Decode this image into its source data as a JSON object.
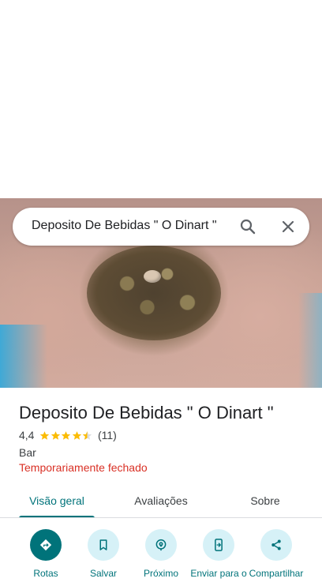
{
  "search": {
    "query": "Deposito De Bebidas \" O Dinart \""
  },
  "place": {
    "title": "Deposito De Bebidas \" O Dinart \"",
    "rating": "4,4",
    "stars": 4.4,
    "review_count": "(11)",
    "category": "Bar",
    "status": "Temporariamente fechado"
  },
  "tabs": [
    {
      "label": "Visão geral",
      "active": true
    },
    {
      "label": "Avaliações",
      "active": false
    },
    {
      "label": "Sobre",
      "active": false
    }
  ],
  "actions": [
    {
      "label": "Rotas",
      "icon": "directions-icon"
    },
    {
      "label": "Salvar",
      "icon": "bookmark-icon"
    },
    {
      "label": "Próximo",
      "icon": "nearby-icon"
    },
    {
      "label": "Enviar para o",
      "icon": "send-to-phone-icon"
    },
    {
      "label": "Compartilhar",
      "icon": "share-icon"
    }
  ],
  "colors": {
    "accent": "#00737a",
    "status_closed": "#d93025",
    "star": "#fbbc04"
  }
}
